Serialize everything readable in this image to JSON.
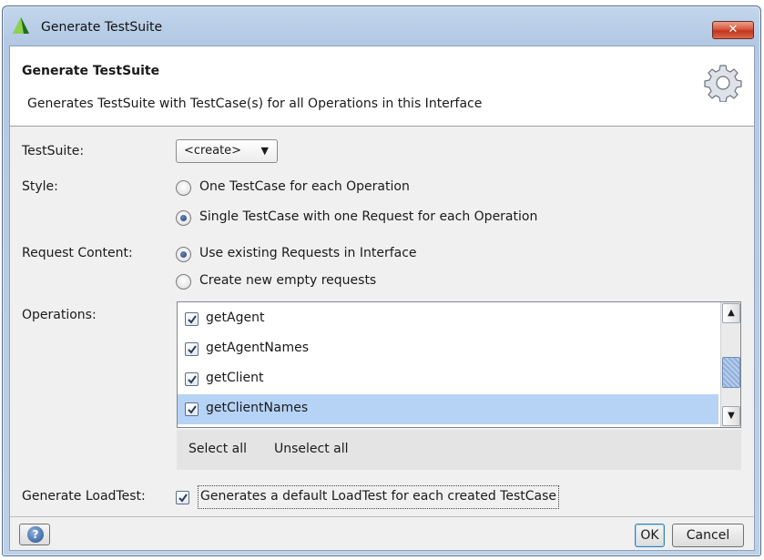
{
  "window": {
    "title": "Generate TestSuite",
    "close_label": "✕"
  },
  "header": {
    "title": "Generate TestSuite",
    "description": "Generates TestSuite with TestCase(s) for all Operations in this Interface"
  },
  "form": {
    "testsuite_label": "TestSuite:",
    "testsuite_value": "<create>",
    "style_label": "Style:",
    "style_options": [
      {
        "label": "One TestCase for each Operation",
        "selected": false
      },
      {
        "label": "Single TestCase with one Request for each Operation",
        "selected": true
      }
    ],
    "request_label": "Request Content:",
    "request_options": [
      {
        "label": "Use existing Requests in Interface",
        "selected": true
      },
      {
        "label": "Create new empty requests",
        "selected": false
      }
    ],
    "operations_label": "Operations:",
    "operations": [
      {
        "label": "getAgent",
        "checked": true,
        "selected": false
      },
      {
        "label": "getAgentNames",
        "checked": true,
        "selected": false
      },
      {
        "label": "getClient",
        "checked": true,
        "selected": false
      },
      {
        "label": "getClientNames",
        "checked": true,
        "selected": true
      }
    ],
    "select_all": "Select all",
    "unselect_all": "Unselect all",
    "loadtest_label": "Generate LoadTest:",
    "loadtest_text": "Generates a default LoadTest for each created TestCase",
    "loadtest_checked": true
  },
  "footer": {
    "help_icon": "?",
    "ok": "OK",
    "cancel": "Cancel"
  },
  "colors": {
    "selection": "#b6d3f6",
    "dialog_bg": "#f0f0f0"
  }
}
